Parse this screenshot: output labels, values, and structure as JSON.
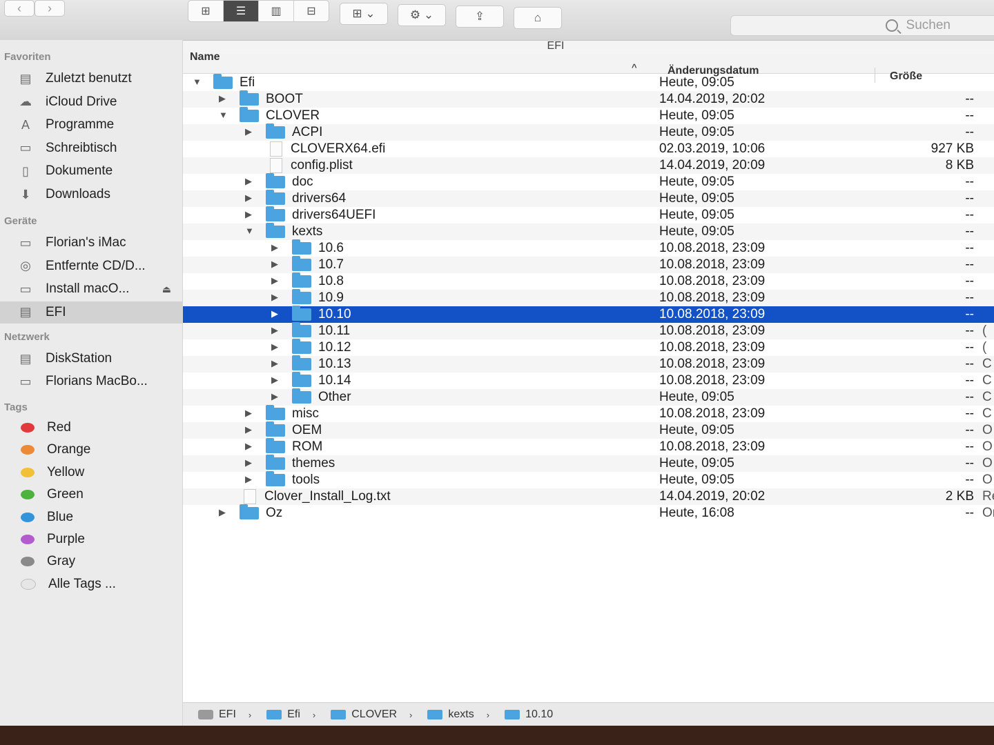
{
  "window": {
    "title": "EFI",
    "toolbar": {
      "back_icon": "‹",
      "forward_icon": "›",
      "view_icons": [
        "⊞",
        "☰",
        "▥",
        "⊟"
      ],
      "active_view_index": 1,
      "arrange_icon": "⊞ ⌄",
      "action_icon": "⚙ ⌄",
      "share_icon": "⇪",
      "tag_icon": "⌂"
    },
    "search": {
      "placeholder": "Suchen"
    }
  },
  "sidebar": {
    "sections": [
      {
        "title": "Favoriten",
        "items": [
          {
            "label": "Zuletzt benutzt",
            "icon": "clock-icon",
            "glyph": "▤"
          },
          {
            "label": "iCloud Drive",
            "icon": "cloud-icon",
            "glyph": "☁"
          },
          {
            "label": "Programme",
            "icon": "applications-icon",
            "glyph": "A"
          },
          {
            "label": "Schreibtisch",
            "icon": "desktop-icon",
            "glyph": "▭"
          },
          {
            "label": "Dokumente",
            "icon": "document-icon",
            "glyph": "▯"
          },
          {
            "label": "Downloads",
            "icon": "download-icon",
            "glyph": "⬇"
          }
        ]
      },
      {
        "title": "Geräte",
        "items": [
          {
            "label": "Florian's iMac",
            "icon": "imac-icon",
            "glyph": "▭"
          },
          {
            "label": "Entfernte CD/D...",
            "icon": "disc-icon",
            "glyph": "◎"
          },
          {
            "label": "Install macO...",
            "icon": "drive-icon",
            "glyph": "▭",
            "eject": "⏏"
          },
          {
            "label": "EFI",
            "icon": "drive-icon",
            "glyph": "▤",
            "selected": true
          }
        ]
      },
      {
        "title": "Netzwerk",
        "items": [
          {
            "label": "DiskStation",
            "icon": "nas-icon",
            "glyph": "▤"
          },
          {
            "label": "Florians MacBo...",
            "icon": "laptop-icon",
            "glyph": "▭"
          }
        ]
      },
      {
        "title": "Tags",
        "tags": [
          {
            "label": "Red",
            "color": "#e2393d"
          },
          {
            "label": "Orange",
            "color": "#ec8a35"
          },
          {
            "label": "Yellow",
            "color": "#f2c037"
          },
          {
            "label": "Green",
            "color": "#4db33e"
          },
          {
            "label": "Blue",
            "color": "#3394db"
          },
          {
            "label": "Purple",
            "color": "#b45bd0"
          },
          {
            "label": "Gray",
            "color": "#8a8a8a"
          },
          {
            "label": "Alle Tags ...",
            "color": "#e6e6e6"
          }
        ]
      }
    ]
  },
  "list": {
    "columns": {
      "name": "Name",
      "sort_indicator": "^",
      "date": "Änderungsdatum",
      "size": "Größe"
    },
    "rows": [
      {
        "name": "Efi",
        "type": "folder",
        "depth": 0,
        "disclosure": "▼",
        "date": "Heute, 09:05",
        "size": "",
        "kind": ""
      },
      {
        "name": "BOOT",
        "type": "folder",
        "depth": 1,
        "disclosure": "▶",
        "date": "14.04.2019, 20:02",
        "size": "--",
        "kind": ""
      },
      {
        "name": "CLOVER",
        "type": "folder",
        "depth": 1,
        "disclosure": "▼",
        "date": "Heute, 09:05",
        "size": "--",
        "kind": ""
      },
      {
        "name": "ACPI",
        "type": "folder",
        "depth": 2,
        "disclosure": "▶",
        "date": "Heute, 09:05",
        "size": "--",
        "kind": ""
      },
      {
        "name": "CLOVERX64.efi",
        "type": "file",
        "depth": 2,
        "disclosure": "",
        "date": "02.03.2019, 10:06",
        "size": "927 KB",
        "kind": ""
      },
      {
        "name": "config.plist",
        "type": "file",
        "depth": 2,
        "disclosure": "",
        "date": "14.04.2019, 20:09",
        "size": "8 KB",
        "kind": ""
      },
      {
        "name": "doc",
        "type": "folder",
        "depth": 2,
        "disclosure": "▶",
        "date": "Heute, 09:05",
        "size": "--",
        "kind": ""
      },
      {
        "name": "drivers64",
        "type": "folder",
        "depth": 2,
        "disclosure": "▶",
        "date": "Heute, 09:05",
        "size": "--",
        "kind": ""
      },
      {
        "name": "drivers64UEFI",
        "type": "folder",
        "depth": 2,
        "disclosure": "▶",
        "date": "Heute, 09:05",
        "size": "--",
        "kind": ""
      },
      {
        "name": "kexts",
        "type": "folder",
        "depth": 2,
        "disclosure": "▼",
        "date": "Heute, 09:05",
        "size": "--",
        "kind": ""
      },
      {
        "name": "10.6",
        "type": "folder",
        "depth": 3,
        "disclosure": "▶",
        "date": "10.08.2018, 23:09",
        "size": "--",
        "kind": ""
      },
      {
        "name": "10.7",
        "type": "folder",
        "depth": 3,
        "disclosure": "▶",
        "date": "10.08.2018, 23:09",
        "size": "--",
        "kind": ""
      },
      {
        "name": "10.8",
        "type": "folder",
        "depth": 3,
        "disclosure": "▶",
        "date": "10.08.2018, 23:09",
        "size": "--",
        "kind": ""
      },
      {
        "name": "10.9",
        "type": "folder",
        "depth": 3,
        "disclosure": "▶",
        "date": "10.08.2018, 23:09",
        "size": "--",
        "kind": ""
      },
      {
        "name": "10.10",
        "type": "folder",
        "depth": 3,
        "disclosure": "▶",
        "date": "10.08.2018, 23:09",
        "size": "--",
        "kind": "",
        "selected": true
      },
      {
        "name": "10.11",
        "type": "folder",
        "depth": 3,
        "disclosure": "▶",
        "date": "10.08.2018, 23:09",
        "size": "--",
        "kind": "("
      },
      {
        "name": "10.12",
        "type": "folder",
        "depth": 3,
        "disclosure": "▶",
        "date": "10.08.2018, 23:09",
        "size": "--",
        "kind": "("
      },
      {
        "name": "10.13",
        "type": "folder",
        "depth": 3,
        "disclosure": "▶",
        "date": "10.08.2018, 23:09",
        "size": "--",
        "kind": "C"
      },
      {
        "name": "10.14",
        "type": "folder",
        "depth": 3,
        "disclosure": "▶",
        "date": "10.08.2018, 23:09",
        "size": "--",
        "kind": "C"
      },
      {
        "name": "Other",
        "type": "folder",
        "depth": 3,
        "disclosure": "▶",
        "date": "Heute, 09:05",
        "size": "--",
        "kind": "C"
      },
      {
        "name": "misc",
        "type": "folder",
        "depth": 2,
        "disclosure": "▶",
        "date": "10.08.2018, 23:09",
        "size": "--",
        "kind": "C"
      },
      {
        "name": "OEM",
        "type": "folder",
        "depth": 2,
        "disclosure": "▶",
        "date": "Heute, 09:05",
        "size": "--",
        "kind": "O"
      },
      {
        "name": "ROM",
        "type": "folder",
        "depth": 2,
        "disclosure": "▶",
        "date": "10.08.2018, 23:09",
        "size": "--",
        "kind": "O"
      },
      {
        "name": "themes",
        "type": "folder",
        "depth": 2,
        "disclosure": "▶",
        "date": "Heute, 09:05",
        "size": "--",
        "kind": "O"
      },
      {
        "name": "tools",
        "type": "folder",
        "depth": 2,
        "disclosure": "▶",
        "date": "Heute, 09:05",
        "size": "--",
        "kind": "O"
      },
      {
        "name": "Clover_Install_Log.txt",
        "type": "file",
        "depth": 1,
        "disclosure": "",
        "date": "14.04.2019, 20:02",
        "size": "2 KB",
        "kind": "Re"
      },
      {
        "name": "Oz",
        "type": "folder",
        "depth": 1,
        "disclosure": "▶",
        "date": "Heute, 16:08",
        "size": "--",
        "kind": "Or"
      }
    ]
  },
  "pathbar": {
    "separator": "›",
    "crumbs": [
      {
        "label": "EFI",
        "type": "drive"
      },
      {
        "label": "Efi",
        "type": "folder"
      },
      {
        "label": "CLOVER",
        "type": "folder"
      },
      {
        "label": "kexts",
        "type": "folder"
      },
      {
        "label": "10.10",
        "type": "folder"
      }
    ]
  }
}
